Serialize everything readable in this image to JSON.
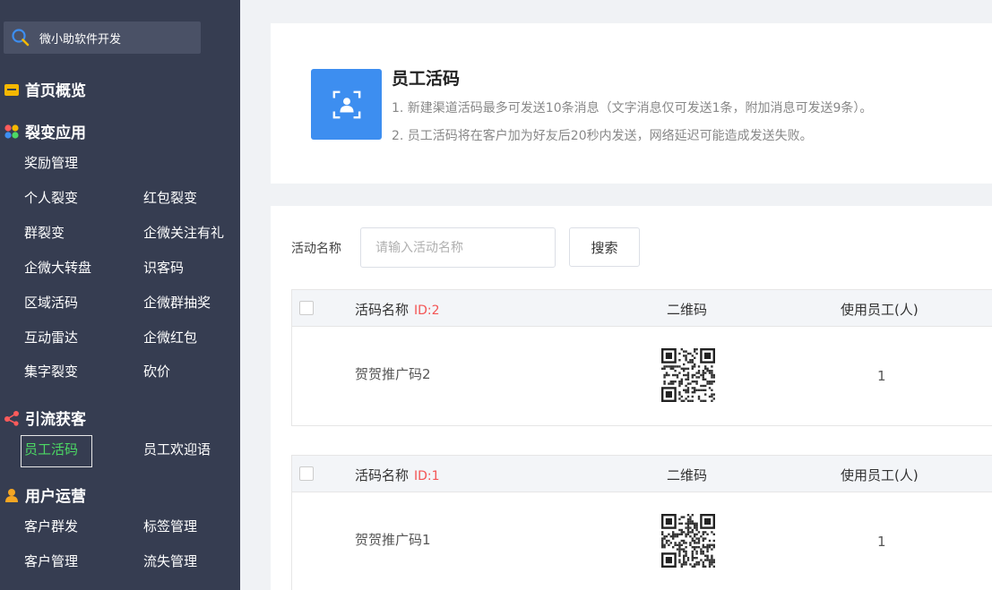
{
  "sidebar": {
    "search_label": "微小助软件开发",
    "sections": {
      "home": "首页概览",
      "fission": "裂变应用",
      "traffic": "引流获客",
      "ops": "用户运营"
    },
    "fission_items": [
      "奖励管理",
      "个人裂变",
      "红包裂变",
      "群裂变",
      "企微关注有礼",
      "企微大转盘",
      "识客码",
      "区域活码",
      "企微群抽奖",
      "互动雷达",
      "企微红包",
      "集字裂变",
      "砍价"
    ],
    "traffic_items": [
      "员工活码",
      "员工欢迎语"
    ],
    "ops_items": [
      "客户群发",
      "标签管理",
      "客户管理",
      "流失管理"
    ]
  },
  "header_card": {
    "title": "员工活码",
    "tip1": "1. 新建渠道活码最多可发送10条消息（文字消息仅可发送1条，附加消息可发送9条）。",
    "tip2": "2. 员工活码将在客户加为好友后20秒内发送，网络延迟可能造成发送失败。"
  },
  "search": {
    "label": "活动名称",
    "placeholder": "请输入活动名称",
    "button": "搜索"
  },
  "table_headers": {
    "name": "活码名称",
    "qr": "二维码",
    "staff": "使用员工(人)"
  },
  "codes": [
    {
      "id_label": "ID:2",
      "name": "贺贺推广码2",
      "staff_count": "1"
    },
    {
      "id_label": "ID:1",
      "name": "贺贺推广码1",
      "staff_count": "1"
    }
  ],
  "colors": {
    "sidebar_bg": "#363d51",
    "active_text": "#4cd964",
    "accent_blue": "#3d8ef0",
    "id_red": "#f35555"
  }
}
